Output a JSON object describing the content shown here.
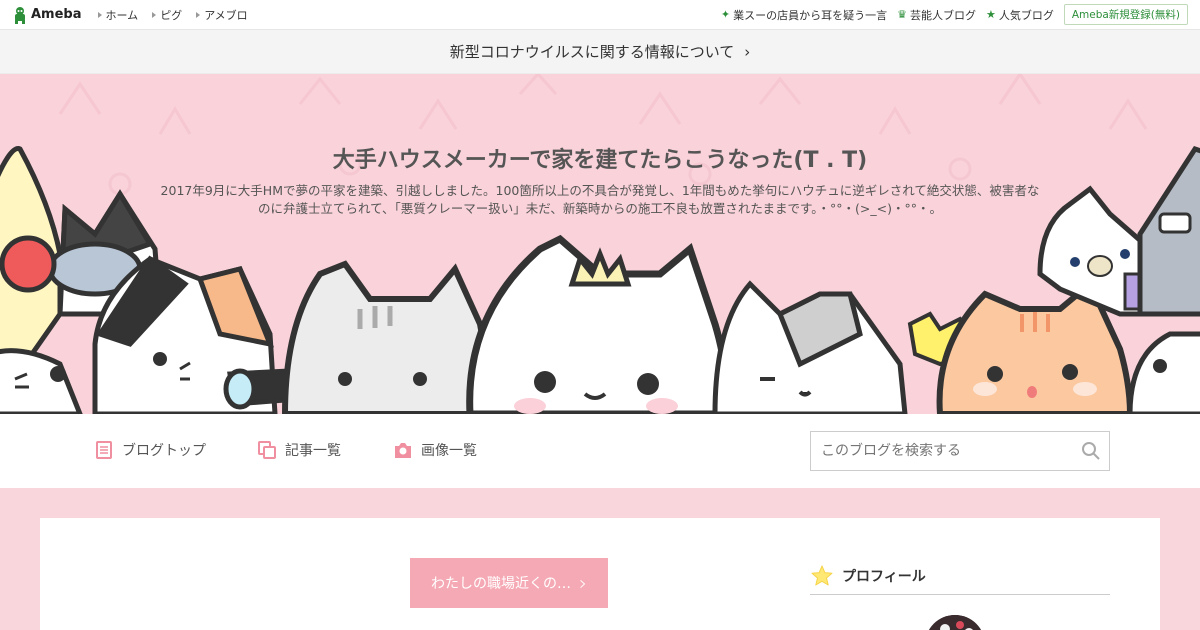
{
  "topbar": {
    "logo": "Ameba",
    "nav": [
      "ホーム",
      "ピグ",
      "アメブロ"
    ],
    "links": [
      {
        "icon": "sparkle-icon",
        "label": "業スーの店員から耳を疑う一言"
      },
      {
        "icon": "crown-icon",
        "label": "芸能人ブログ"
      },
      {
        "icon": "star-icon",
        "label": "人気ブログ"
      }
    ],
    "register": "Ameba新規登録(無料)"
  },
  "notice": {
    "text": "新型コロナウイルスに関する情報について",
    "chevron": "›"
  },
  "blog": {
    "title": "大手ハウスメーカーで家を建てたらこうなった(T . T)",
    "description": "2017年9月に大手HMで夢の平家を建築、引越ししました。100箇所以上の不具合が発覚し、1年間もめた挙句にハウチュに逆ギレされて絶交状態、被害者なのに弁護士立てられて、「悪質クレーマー扱い」未だ、新築時からの施工不良も放置されたままです。・°°・(>_<)・°°・。"
  },
  "nav": {
    "items": [
      {
        "icon": "document-icon",
        "label": "ブログトップ"
      },
      {
        "icon": "copy-icon",
        "label": "記事一覧"
      },
      {
        "icon": "camera-icon",
        "label": "画像一覧"
      }
    ],
    "search_placeholder": "このブログを検索する"
  },
  "content": {
    "article_button": "わたしの職場近くの…",
    "profile_heading": "プロフィール"
  },
  "colors": {
    "pink": "#f9d2da",
    "accent": "#f5a9b4",
    "green": "#2d8f3a"
  }
}
